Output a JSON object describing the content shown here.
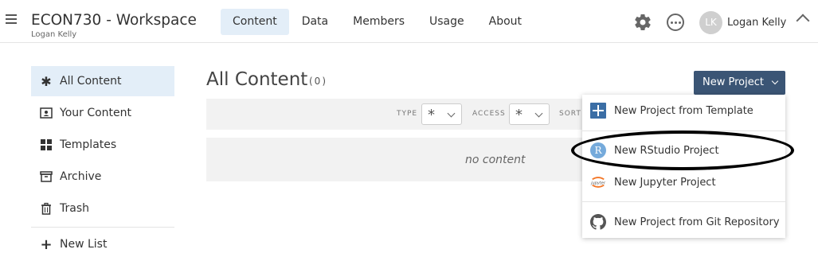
{
  "header": {
    "workspace_title": "ECON730 - Workspace",
    "workspace_owner": "Logan Kelly",
    "nav": [
      {
        "label": "Content",
        "active": true
      },
      {
        "label": "Data",
        "active": false
      },
      {
        "label": "Members",
        "active": false
      },
      {
        "label": "Usage",
        "active": false
      },
      {
        "label": "About",
        "active": false
      }
    ],
    "user": {
      "initials": "LK",
      "name": "Logan Kelly"
    },
    "icons": [
      "menu-icon",
      "gear-icon",
      "more-icon",
      "chevron-up-icon"
    ]
  },
  "sidebar": {
    "items": [
      {
        "label": "All Content",
        "icon": "asterisk-icon",
        "active": true
      },
      {
        "label": "Your Content",
        "icon": "person-card-icon",
        "active": false
      },
      {
        "label": "Templates",
        "icon": "grid-icon",
        "active": false
      },
      {
        "label": "Archive",
        "icon": "archive-icon",
        "active": false
      },
      {
        "label": "Trash",
        "icon": "trash-icon",
        "active": false
      }
    ],
    "new_list": {
      "label": "New List",
      "icon": "plus-icon"
    }
  },
  "main": {
    "title": "All Content",
    "count": "(0)",
    "filters": [
      {
        "label": "TYPE",
        "value": "*"
      },
      {
        "label": "ACCESS",
        "value": "*"
      },
      {
        "label": "SORT"
      }
    ],
    "empty_text": "no content"
  },
  "new_project": {
    "button_label": "New Project",
    "menu": [
      {
        "label": "New Project from Template",
        "icon": "template-plus-icon"
      },
      {
        "label": "New RStudio Project",
        "icon": "rstudio-icon",
        "highlighted_by_annotation": true
      },
      {
        "label": "New Jupyter Project",
        "icon": "jupyter-icon"
      },
      {
        "label": "New Project from Git Repository",
        "icon": "github-icon"
      }
    ]
  },
  "colors": {
    "accent_bg": "#e3eef8",
    "button_bg": "#3b5575",
    "panel_bg": "#f2f2f2",
    "rstudio_blue": "#75aadb",
    "jupyter_orange": "#f37626",
    "annotation": "#000000"
  }
}
